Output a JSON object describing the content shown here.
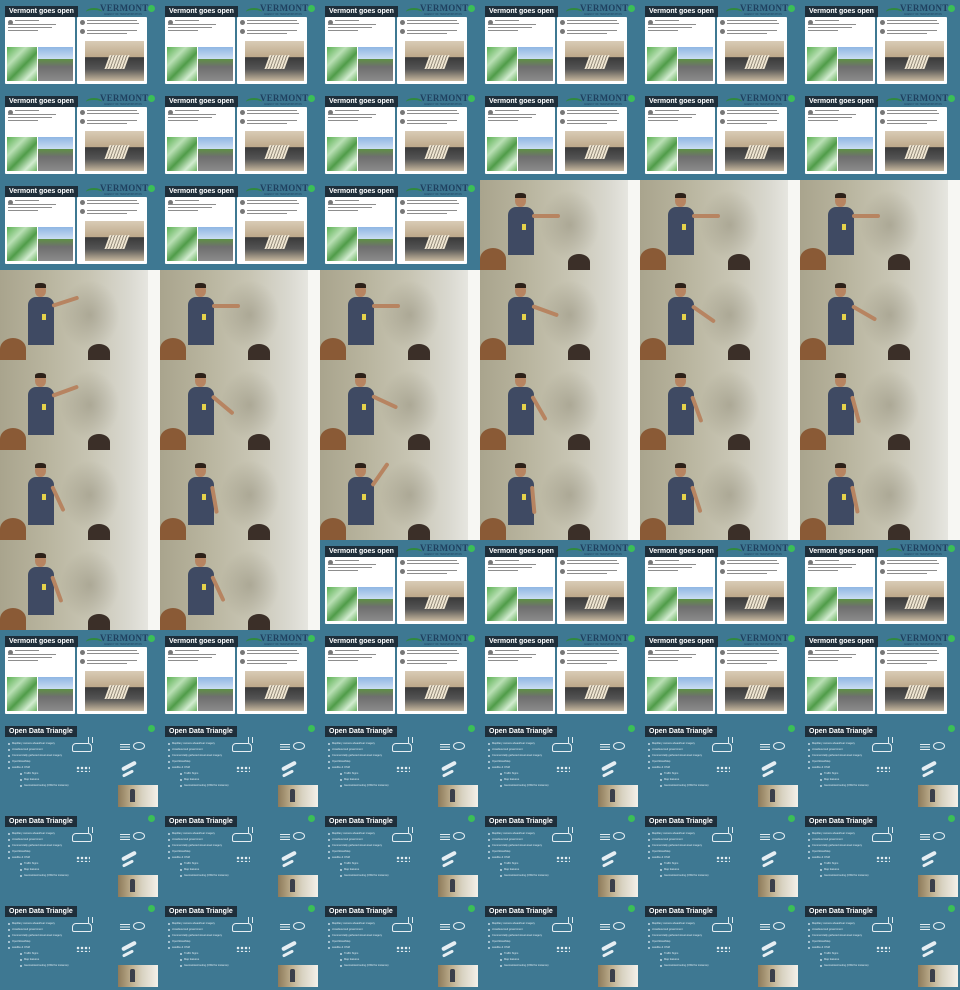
{
  "sheet": {
    "columns": 6,
    "rows": 11
  },
  "slides": {
    "vermont": {
      "title": "Vermont goes open",
      "logo_word": "VERMONT",
      "logo_sub": "AGENCY OF TRANSPORTATION"
    },
    "triangle": {
      "title": "Open Data Triangle",
      "items": [
        "Mapillary camera ahead/rear imagery",
        "crowdsourced government",
        "Commercially gathered street-level imagery",
        "OpenStreetMap",
        "satellite & OSM",
        "Traffic Signs",
        "Map features",
        "Geometries/routing (OSM for instance)"
      ]
    }
  },
  "frames": [
    "vermont",
    "vermont",
    "vermont",
    "vermont",
    "vermont",
    "vermont",
    "vermont",
    "vermont",
    "vermont",
    "vermont",
    "vermont",
    "vermont",
    "vermont",
    "vermont",
    "vermont",
    "speaker",
    "speaker",
    "speaker",
    "speaker",
    "speaker",
    "speaker",
    "speaker",
    "speaker",
    "speaker",
    "speaker",
    "speaker",
    "speaker",
    "speaker",
    "speaker",
    "speaker",
    "speaker",
    "speaker",
    "speaker",
    "speaker",
    "speaker",
    "speaker",
    "speaker",
    "speaker",
    "vermont",
    "vermont",
    "vermont",
    "vermont",
    "vermont",
    "vermont",
    "vermont",
    "vermont",
    "vermont",
    "vermont",
    "triangle",
    "triangle",
    "triangle",
    "triangle",
    "triangle",
    "triangle",
    "triangle",
    "triangle",
    "triangle",
    "triangle",
    "triangle",
    "triangle",
    "triangle",
    "triangle",
    "triangle",
    "triangle",
    "triangle",
    "triangle"
  ],
  "speaker_arm_angles": [
    0,
    0,
    0,
    -18,
    0,
    0,
    20,
    35,
    30,
    -20,
    40,
    25,
    60,
    70,
    75,
    65,
    80,
    -55,
    85,
    72,
    78,
    70,
    65,
    80,
    75,
    60
  ]
}
